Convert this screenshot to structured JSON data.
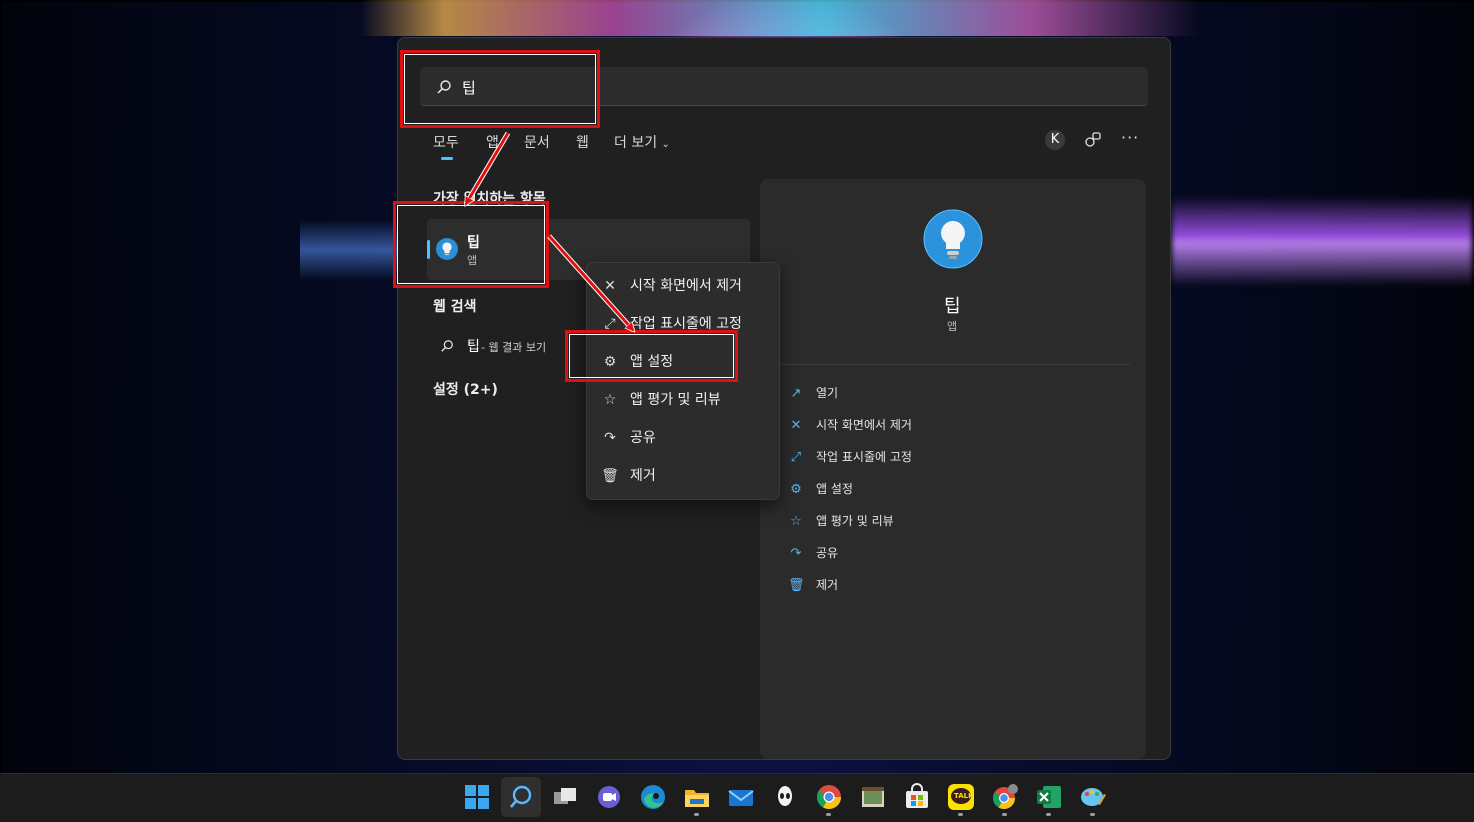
{
  "search": {
    "query": "팁"
  },
  "tabs": [
    {
      "label": "모두"
    },
    {
      "label": "앱"
    },
    {
      "label": "문서"
    },
    {
      "label": "웹"
    },
    {
      "label": "더 보기"
    }
  ],
  "header": {
    "avatar_letter": "K"
  },
  "sections": {
    "best_match": "가장 일치하는 항목",
    "web_search": "웹 검색",
    "settings": "설정 (2+)"
  },
  "best_match_item": {
    "name": "팁",
    "type": "앱"
  },
  "web_result": {
    "query": "팁",
    "suffix": " - 웹 결과 보기"
  },
  "context_menu": [
    {
      "label": "시작 화면에서 제거",
      "icon": "unpin-icon"
    },
    {
      "label": "작업 표시줄에 고정",
      "icon": "pin-icon"
    },
    {
      "label": "앱 설정",
      "icon": "gear-icon"
    },
    {
      "label": "앱 평가 및 리뷰",
      "icon": "star-list-icon"
    },
    {
      "label": "공유",
      "icon": "share-icon"
    },
    {
      "label": "제거",
      "icon": "trash-icon"
    }
  ],
  "details": {
    "name": "팁",
    "type": "앱",
    "actions": [
      {
        "label": "열기",
        "icon": "open-external-icon"
      },
      {
        "label": "시작 화면에서 제거",
        "icon": "unpin-icon"
      },
      {
        "label": "작업 표시줄에 고정",
        "icon": "pin-icon"
      },
      {
        "label": "앱 설정",
        "icon": "gear-icon"
      },
      {
        "label": "앱 평가 및 리뷰",
        "icon": "star-list-icon"
      },
      {
        "label": "공유",
        "icon": "share-icon"
      },
      {
        "label": "제거",
        "icon": "trash-icon"
      }
    ]
  },
  "taskbar": {
    "icons": [
      "windows-start-icon",
      "search-icon",
      "task-view-icon",
      "chat-icon",
      "edge-icon",
      "file-explorer-icon",
      "mail-icon",
      "alienware-icon",
      "chrome-icon",
      "photo-viewer-icon",
      "store-icon",
      "kakaotalk-icon",
      "chrome-profile-icon",
      "excel-icon",
      "paint-icon"
    ],
    "kakaotalk_text": "TALK"
  },
  "colors": {
    "accent": "#4cc2ff",
    "annotation_red": "#e01010",
    "panel": "#202020",
    "pane": "#2b2b2b"
  }
}
